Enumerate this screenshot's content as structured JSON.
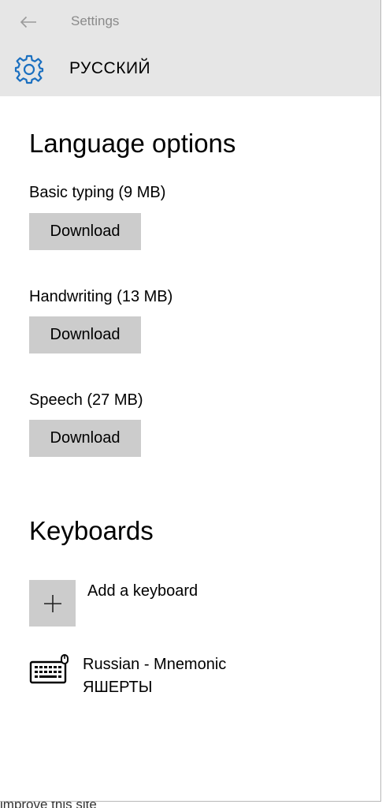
{
  "titlebar": {
    "back_icon": "back-arrow-icon",
    "app_title": "Settings"
  },
  "header": {
    "icon": "gear-icon",
    "title": "РУССКИЙ"
  },
  "language_options": {
    "title": "Language options",
    "items": [
      {
        "label": "Basic typing (9 MB)",
        "button": "Download"
      },
      {
        "label": "Handwriting (13 MB)",
        "button": "Download"
      },
      {
        "label": "Speech (27 MB)",
        "button": "Download"
      }
    ]
  },
  "keyboards": {
    "title": "Keyboards",
    "add_icon": "plus-icon",
    "add_label": "Add a keyboard",
    "items": [
      {
        "icon": "keyboard-icon",
        "name": "Russian - Mnemonic",
        "layout": "ЯШЕРТЫ"
      }
    ]
  },
  "background": {
    "partial_text": "improve this site"
  }
}
